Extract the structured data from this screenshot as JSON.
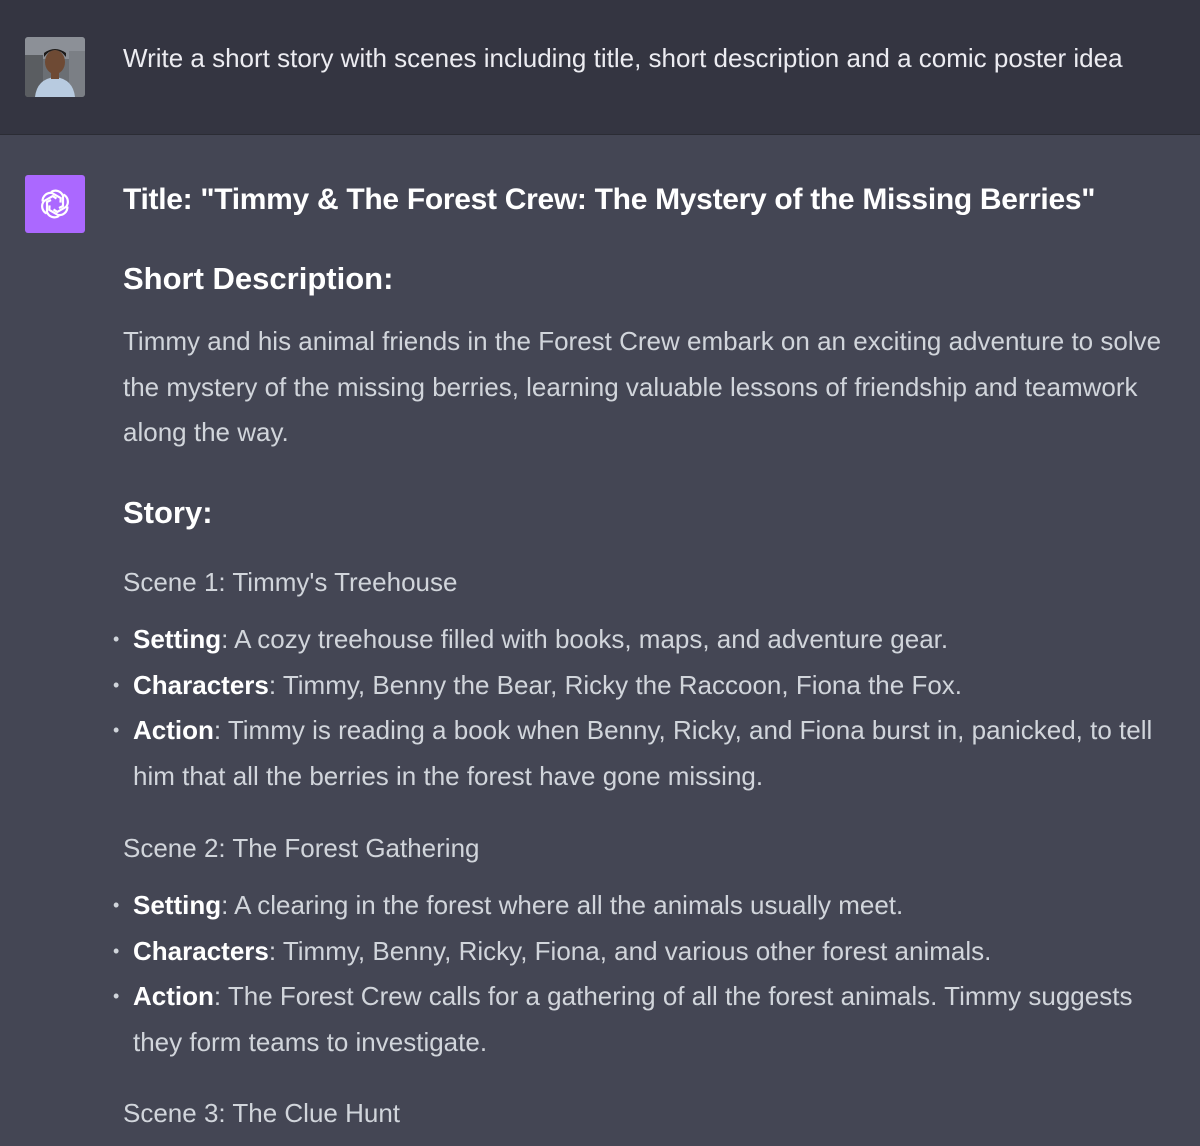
{
  "user_message": {
    "text": "Write a short story with scenes including title, short description and a comic poster idea"
  },
  "response": {
    "title": "Title: \"Timmy & The Forest Crew: The Mystery of the Missing Berries\"",
    "short_description_heading": "Short Description:",
    "short_description": "Timmy and his animal friends in the Forest Crew embark on an exciting adventure to solve the mystery of the missing berries, learning valuable lessons of friendship and teamwork along the way.",
    "story_heading": "Story:",
    "scenes": [
      {
        "title": "Scene 1: Timmy's Treehouse",
        "items": [
          {
            "label": "Setting",
            "text": ": A cozy treehouse filled with books, maps, and adventure gear."
          },
          {
            "label": "Characters",
            "text": ": Timmy, Benny the Bear, Ricky the Raccoon, Fiona the Fox."
          },
          {
            "label": "Action",
            "text": ": Timmy is reading a book when Benny, Ricky, and Fiona burst in, panicked, to tell him that all the berries in the forest have gone missing."
          }
        ]
      },
      {
        "title": "Scene 2: The Forest Gathering",
        "items": [
          {
            "label": "Setting",
            "text": ": A clearing in the forest where all the animals usually meet."
          },
          {
            "label": "Characters",
            "text": ": Timmy, Benny, Ricky, Fiona, and various other forest animals."
          },
          {
            "label": "Action",
            "text": ": The Forest Crew calls for a gathering of all the forest animals. Timmy suggests they form teams to investigate."
          }
        ]
      },
      {
        "title": "Scene 3: The Clue Hunt",
        "items": []
      }
    ]
  },
  "colors": {
    "user_bg": "#343541",
    "assistant_bg": "#444654",
    "assistant_avatar": "#ab68ff",
    "text": "#d1d5db",
    "heading": "#ffffff"
  },
  "icons": {
    "user_avatar": "user-photo-avatar",
    "assistant_avatar": "openai-logo-icon",
    "bullet": "bullet-dot-icon"
  }
}
